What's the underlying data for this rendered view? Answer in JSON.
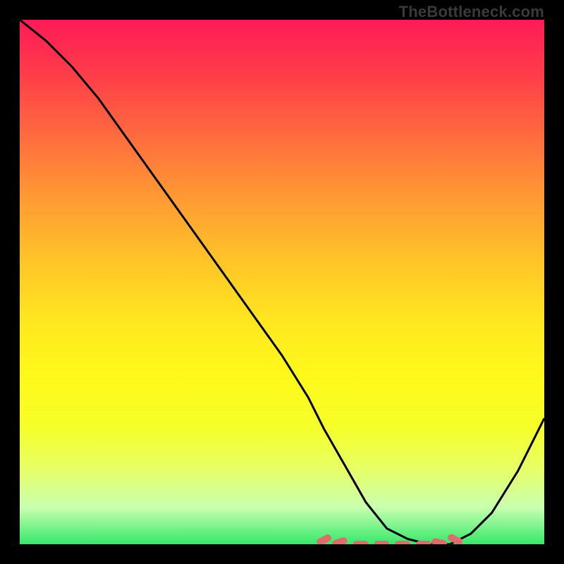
{
  "watermark": "TheBottleneck.com",
  "colors": {
    "background": "#000000",
    "gradient_top": "#ff1a57",
    "gradient_bottom": "#35e86a",
    "curve_stroke": "#000000",
    "marker_fill": "#e06b6b"
  },
  "chart_data": {
    "type": "line",
    "title": "",
    "xlabel": "",
    "ylabel": "",
    "xlim": [
      0,
      100
    ],
    "ylim": [
      0,
      100
    ],
    "x": [
      0,
      5,
      10,
      15,
      20,
      25,
      30,
      35,
      40,
      45,
      50,
      55,
      58,
      62,
      66,
      70,
      74,
      78,
      82,
      86,
      90,
      95,
      100
    ],
    "values": [
      100,
      96,
      91,
      85,
      78,
      71,
      64,
      57,
      50,
      43,
      36,
      28,
      22,
      15,
      8,
      3,
      1,
      0,
      0,
      2,
      6,
      14,
      24
    ],
    "marker_points": [
      {
        "x": 58,
        "y": 0.8
      },
      {
        "x": 61,
        "y": 0.4
      },
      {
        "x": 65,
        "y": 0.0
      },
      {
        "x": 69,
        "y": 0.0
      },
      {
        "x": 73,
        "y": 0.0
      },
      {
        "x": 77,
        "y": 0.0
      },
      {
        "x": 80,
        "y": 0.3
      },
      {
        "x": 83,
        "y": 0.9
      }
    ]
  }
}
